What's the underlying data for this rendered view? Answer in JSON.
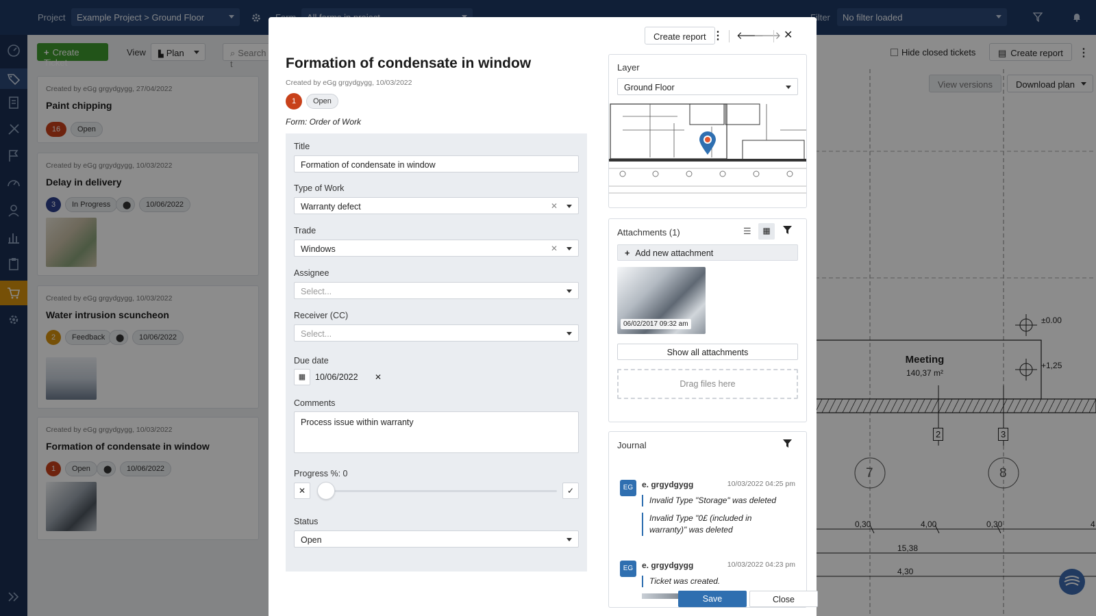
{
  "topbar": {
    "project_label": "Project",
    "project_value": "Example Project > Ground Floor",
    "form_label": "Form",
    "form_value": "All forms in project",
    "filter_label": "Filter",
    "filter_value": "No filter loaded"
  },
  "list": {
    "create_ticket": "Create Ticket",
    "view_label": "View",
    "view_value": "Plan",
    "search_placeholder": "Search t",
    "tickets": [
      {
        "meta": "Created by eGg grgydgygg, 27/04/2022",
        "title": "Paint chipping",
        "num": "16",
        "status": "Open",
        "num_color": "#c8411a"
      },
      {
        "meta": "Created by eGg grgydgygg, 10/03/2022",
        "title": "Delay in delivery",
        "num": "3",
        "status": "In Progress",
        "date": "10/06/2022",
        "num_color": "#2c3f8a"
      },
      {
        "meta": "Created by eGg grgydgygg, 10/03/2022",
        "title": "Water intrusion scuncheon",
        "num": "2",
        "status": "Feedback",
        "date": "10/06/2022",
        "num_color": "#d8920d"
      },
      {
        "meta": "Created by eGg grgydgygg, 10/03/2022",
        "title": "Formation of condensate in window",
        "num": "1",
        "status": "Open",
        "date": "10/06/2022",
        "num_color": "#c8411a"
      }
    ]
  },
  "plan": {
    "hide_closed": "Hide closed tickets",
    "create_report": "Create report",
    "view_versions": "View versions",
    "download_plan": "Download plan",
    "room_name": "Meeting",
    "room_area": "140,37 m²",
    "level_0": "±0.00",
    "level_1": "+1,25",
    "axis_7": "7",
    "axis_8": "8",
    "marker_2": "2",
    "marker_3": "3",
    "dim_030a": "0,30",
    "dim_400": "4,00",
    "dim_030b": "0,30",
    "dim_4": "4",
    "dim_1538": "15,38",
    "dim_430": "4,30"
  },
  "modal": {
    "create_report": "Create report",
    "title": "Formation of condensate in window",
    "created": "Created by eGg grgydgygg, 10/03/2022",
    "num": "1",
    "status_pill": "Open",
    "form_name": "Form: Order of Work",
    "fields": {
      "title_label": "Title",
      "title_value": "Formation of condensate in window",
      "type_label": "Type of Work",
      "type_value": "Warranty defect",
      "trade_label": "Trade",
      "trade_value": "Windows",
      "assignee_label": "Assignee",
      "assignee_placeholder": "Select...",
      "receiver_label": "Receiver (CC)",
      "receiver_placeholder": "Select...",
      "due_label": "Due date",
      "due_value": "10/06/2022",
      "comments_label": "Comments",
      "comments_value": "Process issue within warranty",
      "progress_label": "Progress %: 0",
      "progress_value": 0,
      "status_label": "Status",
      "status_value": "Open"
    },
    "layer": {
      "title": "Layer",
      "value": "Ground Floor"
    },
    "attachments": {
      "title": "Attachments (1)",
      "add": "Add new attachment",
      "thumb_time": "06/02/2017 09:32 am",
      "show_all": "Show all attachments",
      "drag": "Drag files here"
    },
    "journal": {
      "title": "Journal",
      "entries": [
        {
          "avatar": "EG",
          "name": "e. grgydgygg",
          "time": "10/03/2022 04:25 pm",
          "lines": [
            "Invalid Type \"Storage\" was deleted",
            "Invalid Type \"0£ (included in warranty)\" was deleted"
          ]
        },
        {
          "avatar": "EG",
          "name": "e. grgydgygg",
          "time": "10/03/2022 04:23 pm",
          "lines": [
            "Ticket was created."
          ]
        }
      ]
    },
    "save": "Save",
    "close": "Close"
  },
  "colors": {
    "accent": "#2f6fb0",
    "create_green": "#3f9a2e",
    "topbar": "#1e3a64"
  }
}
